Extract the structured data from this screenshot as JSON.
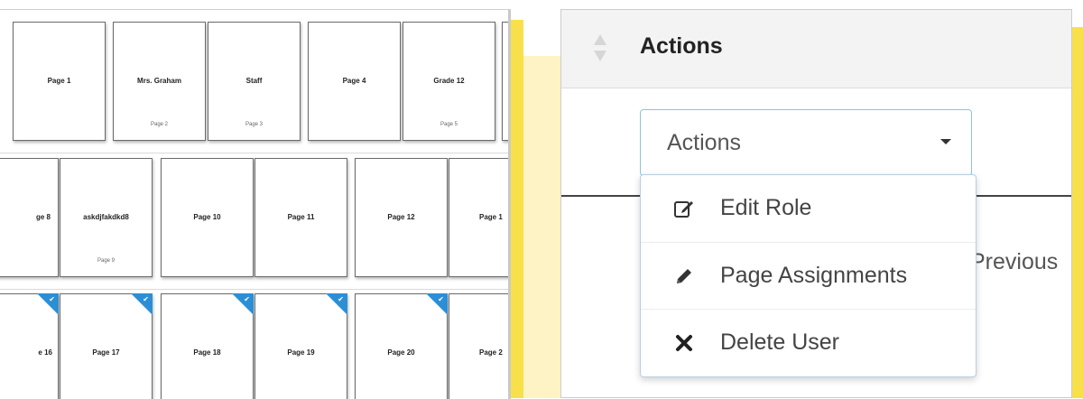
{
  "ladder": {
    "rows": [
      {
        "pages": [
          {
            "title": "Page 1",
            "sub": "",
            "flag": false
          },
          {
            "title": "Mrs. Graham",
            "sub": "Page 2",
            "flag": false
          },
          {
            "title": "Staff",
            "sub": "Page 3",
            "flag": false
          },
          {
            "title": "Page 4",
            "sub": "",
            "flag": false
          },
          {
            "title": "Grade 12",
            "sub": "Page 5",
            "flag": false
          },
          {
            "title": "",
            "sub": "",
            "flag": false
          }
        ]
      },
      {
        "pages": [
          {
            "title": "ge 8",
            "sub": "",
            "flag": false
          },
          {
            "title": "askdjfakdkd8",
            "sub": "Page 9",
            "flag": false
          },
          {
            "title": "Page 10",
            "sub": "",
            "flag": false
          },
          {
            "title": "Page 11",
            "sub": "",
            "flag": false
          },
          {
            "title": "Page 12",
            "sub": "",
            "flag": false
          },
          {
            "title": "Page 1",
            "sub": "",
            "flag": false
          }
        ]
      },
      {
        "pages": [
          {
            "title": "e 16",
            "sub": "",
            "flag": true
          },
          {
            "title": "Page 17",
            "sub": "",
            "flag": true
          },
          {
            "title": "Page 18",
            "sub": "",
            "flag": true
          },
          {
            "title": "Page 19",
            "sub": "",
            "flag": true
          },
          {
            "title": "Page 20",
            "sub": "",
            "flag": true
          },
          {
            "title": "Page 2",
            "sub": "",
            "flag": false
          }
        ]
      }
    ]
  },
  "panel": {
    "header_title": "Actions",
    "previous_label": "Previous",
    "dropdown": {
      "button_label": "Actions",
      "items": [
        {
          "label": "Edit Role",
          "icon": "edit-icon"
        },
        {
          "label": "Page Assignments",
          "icon": "pencil-icon"
        },
        {
          "label": "Delete User",
          "icon": "times-icon"
        }
      ]
    }
  },
  "colors": {
    "accent_blue": "#2c8fd6",
    "backdrop_yellow": "#fdf3c4",
    "bar_yellow": "#f8e04a",
    "button_border": "#8fc3dd"
  }
}
